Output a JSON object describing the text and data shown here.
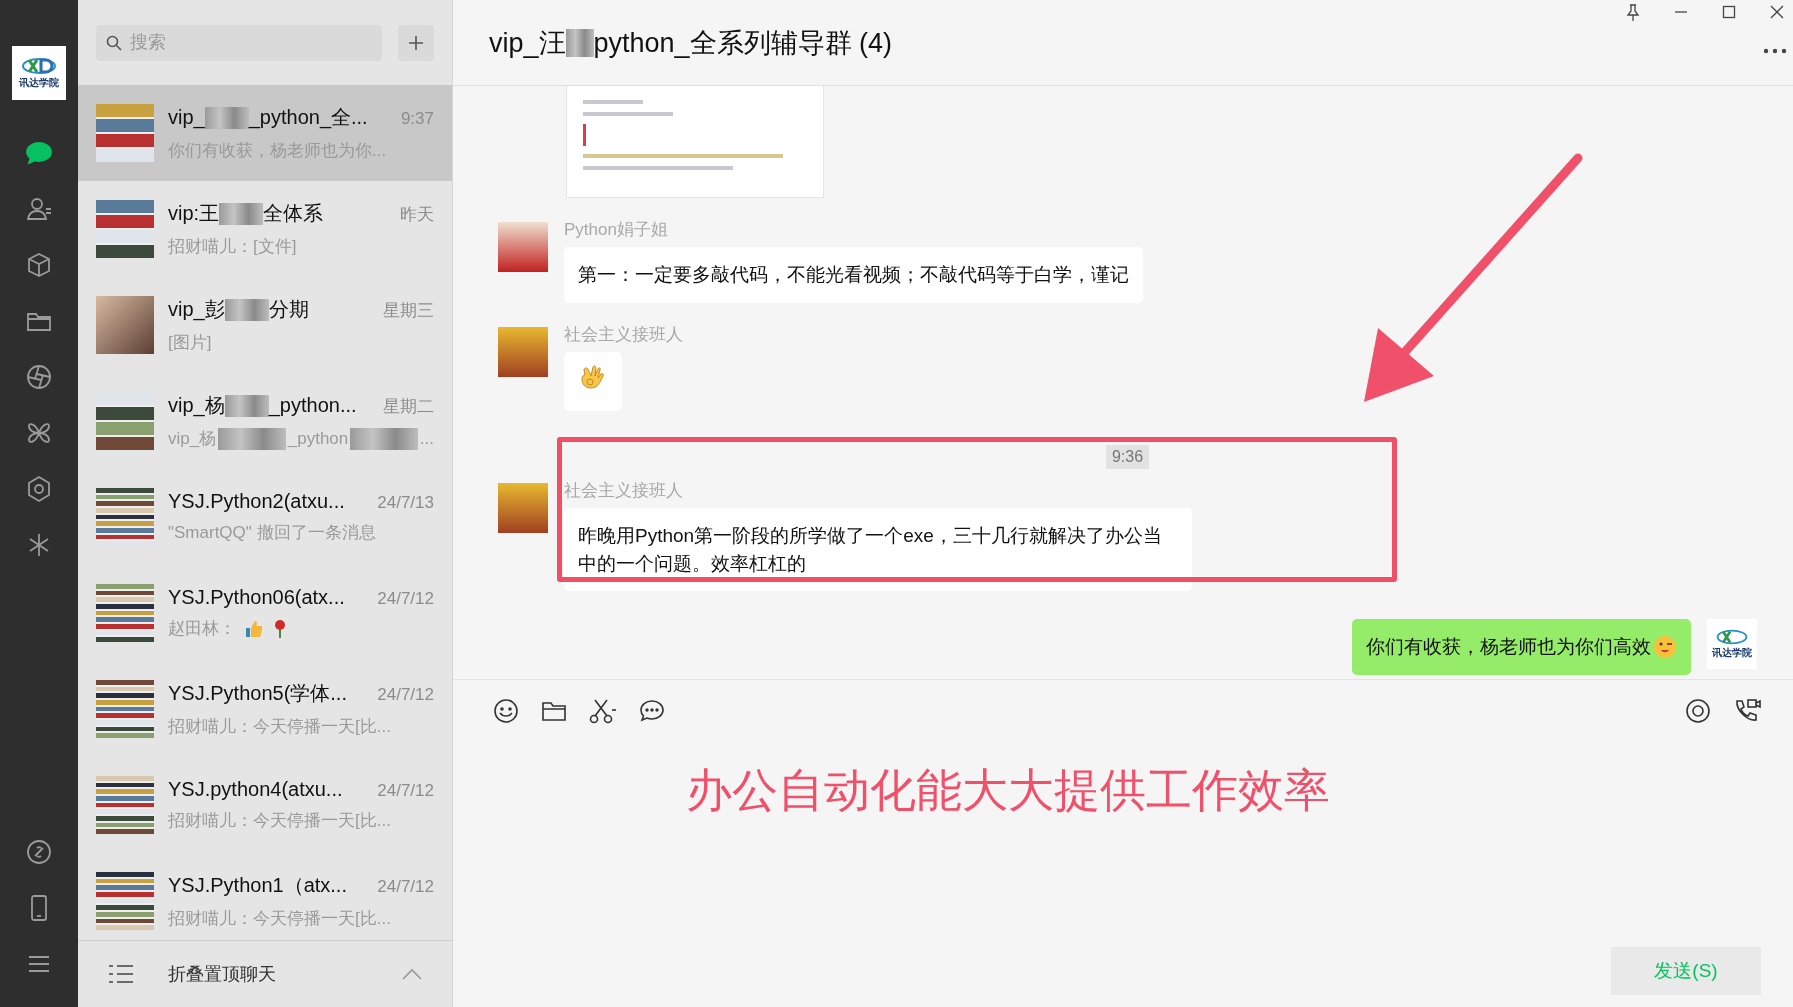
{
  "sidebar": {
    "logo_text": "讯达学院",
    "items": [
      {
        "selected": true
      },
      {
        "selected": false
      },
      {
        "selected": false
      },
      {
        "selected": false
      },
      {
        "selected": false
      },
      {
        "selected": false
      },
      {
        "selected": false
      },
      {
        "selected": false
      }
    ]
  },
  "search": {
    "placeholder": "搜索"
  },
  "chats": [
    {
      "name": [
        "vip_",
        "_python_全..."
      ],
      "time": "9:37",
      "preview": [
        "你们有收获，杨老师也为你..."
      ],
      "kind": "group4",
      "selected": true
    },
    {
      "name": [
        "vip:王",
        "全体系"
      ],
      "time": "昨天",
      "preview": [
        "招财喵儿：[文件]"
      ],
      "kind": "group4",
      "selected": false
    },
    {
      "name": [
        "vip_彭",
        "分期"
      ],
      "time": "星期三",
      "preview": [
        "[图片]"
      ],
      "kind": "photo",
      "selected": false
    },
    {
      "name": [
        "vip_杨",
        "_python..."
      ],
      "time": "星期二",
      "preview": [
        "vip_杨",
        "_python",
        "..."
      ],
      "kind": "group4",
      "selected": false
    },
    {
      "name": [
        "YSJ.Python2(atxu..."
      ],
      "time": "24/7/13",
      "preview": [
        "\"SmartQQ\" 撤回了一条消息"
      ],
      "kind": "group9",
      "selected": false
    },
    {
      "name": [
        "YSJ.Python06(atx..."
      ],
      "time": "24/7/12",
      "preview": [
        "赵田林："
      ],
      "kind": "group9",
      "selected": false
    },
    {
      "name": [
        "YSJ.Python5(学体..."
      ],
      "time": "24/7/12",
      "preview": [
        "招财喵儿：今天停播一天[比..."
      ],
      "kind": "group9",
      "selected": false
    },
    {
      "name": [
        "YSJ.python4(atxu..."
      ],
      "time": "24/7/12",
      "preview": [
        "招财喵儿：今天停播一天[比..."
      ],
      "kind": "group9",
      "selected": false
    },
    {
      "name": [
        "YSJ.Python1（atx..."
      ],
      "time": "24/7/12",
      "preview": [
        "招财喵儿：今天停播一天[比..."
      ],
      "kind": "group9",
      "selected": false
    }
  ],
  "fold_bar": {
    "label": "折叠置顶聊天"
  },
  "conversation": {
    "title": [
      "vip_汪",
      "python_全系列辅导群 (4)"
    ],
    "messages": [
      {
        "kind": "document"
      },
      {
        "kind": "text",
        "sender": "Python娟子姐",
        "text": "第一：一定要多敲代码，不能光看视频；不敲代码等于白学，谨记"
      },
      {
        "kind": "sticker",
        "sender": "社会主义接班人"
      },
      {
        "kind": "time",
        "text": "9:36"
      },
      {
        "kind": "text",
        "sender": "社会主义接班人",
        "text": "昨晚用Python第一阶段的所学做了一个exe，三十几行就解决了办公当中的一个问题。效率杠杠的"
      },
      {
        "kind": "sent",
        "text": "你们有收获，杨老师也为你们高效",
        "logo_text": "讯达学院"
      }
    ],
    "input_value": "办公自动化能大大提供工作效率",
    "send_label": "发送(S)"
  }
}
